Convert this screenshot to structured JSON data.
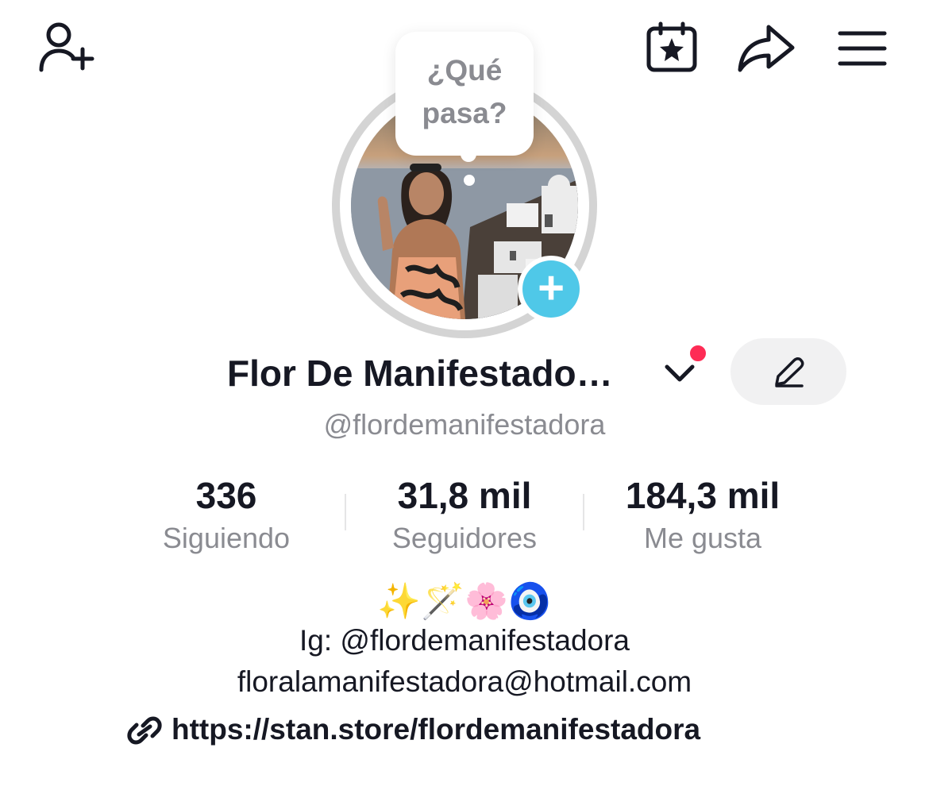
{
  "header": {
    "icons": [
      "add-friend-icon",
      "calendar-star-icon",
      "share-icon",
      "menu-icon"
    ]
  },
  "avatar": {
    "note_line1": "¿Qué",
    "note_line2": "pasa?",
    "add_story_symbol": "+"
  },
  "profile": {
    "display_name": "Flor De Manifestado…",
    "username": "@flordemanifestadora"
  },
  "stats": [
    {
      "value": "336",
      "label": "Siguiendo"
    },
    {
      "value": "31,8 mil",
      "label": "Seguidores"
    },
    {
      "value": "184,3 mil",
      "label": "Me gusta"
    }
  ],
  "bio": {
    "emojis": "✨🪄🌸🧿",
    "instagram": "Ig: @flordemanifestadora",
    "email": "floralamanifestadora@hotmail.com",
    "link": "https://stan.store/flordemanifestadora"
  },
  "colors": {
    "accent_blue": "#4fc8e8",
    "notification_red": "#fe2c55",
    "secondary_text": "#8a8b91",
    "primary_text": "#161823"
  }
}
